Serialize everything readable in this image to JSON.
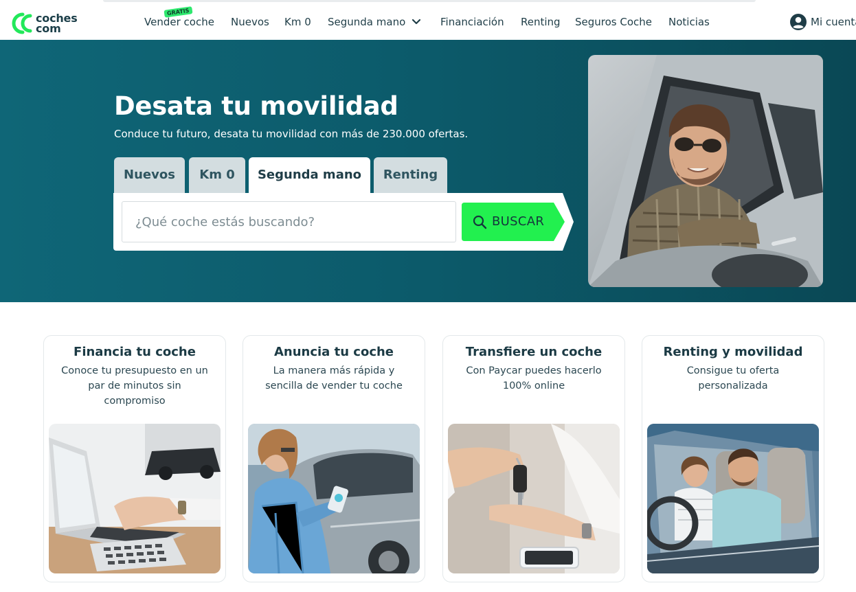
{
  "header": {
    "logo_text_line1": "coches",
    "logo_text_line2": "com",
    "nav": [
      {
        "label": "Vender coche"
      },
      {
        "label": "Nuevos"
      },
      {
        "label": "Km 0"
      },
      {
        "label": "Segunda mano"
      },
      {
        "label": "Financiación"
      },
      {
        "label": "Renting"
      },
      {
        "label": "Seguros Coche"
      },
      {
        "label": "Noticias"
      }
    ],
    "gratis_badge": "GRATIS",
    "account_label": "Mi cuenta",
    "icons": {
      "account": "user-circle-icon",
      "dropdown": "chevron-down-icon",
      "logo": "coches-logo-icon"
    }
  },
  "hero": {
    "title": "Desata tu movilidad",
    "subtitle": "Conduce tu futuro, desata tu movilidad con más de 230.000 ofertas.",
    "tabs": [
      {
        "label": "Nuevos",
        "active": false
      },
      {
        "label": "Km 0",
        "active": false
      },
      {
        "label": "Segunda mano",
        "active": true
      },
      {
        "label": "Renting",
        "active": false
      }
    ],
    "search": {
      "placeholder": "¿Qué coche estás buscando?",
      "value": "",
      "button_label": "BUSCAR",
      "button_icon": "search-icon"
    },
    "photo": "man-driving-car-photo"
  },
  "cards": [
    {
      "title": "Financia tu coche",
      "description": "Conoce tu presupuesto en un par de minutos sin compromiso",
      "image": "laptop-calculator-photo"
    },
    {
      "title": "Anuncia tu coche",
      "description": "La manera más rápida y sencilla de vender tu coche",
      "image": "woman-phone-car-photo"
    },
    {
      "title": "Transfiere un coche",
      "description": "Con Paycar puedes hacerlo 100% online",
      "image": "car-key-handover-photo"
    },
    {
      "title": "Renting y movilidad",
      "description": "Consigue tu oferta personalizada",
      "image": "couple-in-car-photo"
    }
  ],
  "colors": {
    "brand_green": "#22e85a",
    "hero_teal": "#0c5a6a",
    "text_dark": "#1f3d47"
  }
}
